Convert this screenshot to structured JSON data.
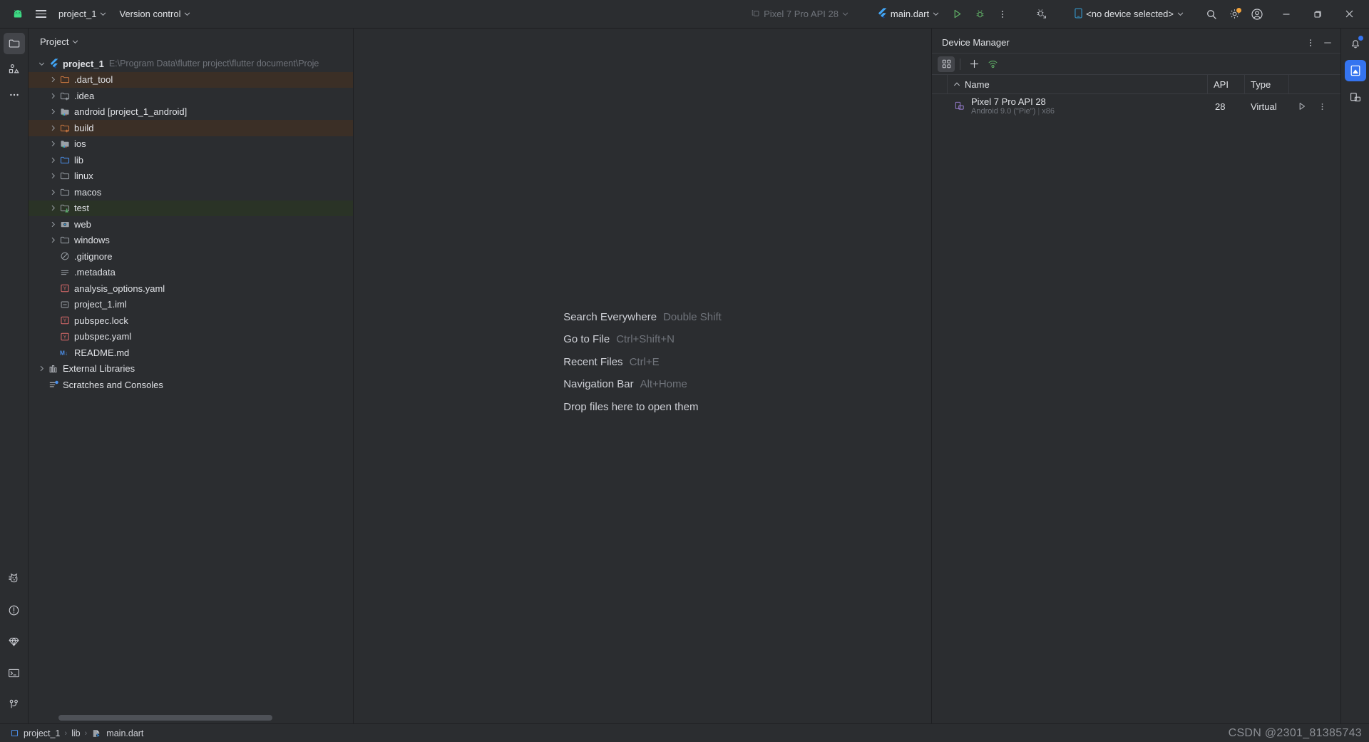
{
  "toolbar": {
    "logo_icon": "android-studio-logo-icon",
    "menu_icon": "hamburger-menu-icon",
    "project_name": "project_1",
    "version_control": "Version control",
    "device_preview": "Pixel 7 Pro API 28",
    "run_config": "main.dart",
    "run_icon": "run-play-icon",
    "debug_icon": "debug-bug-icon",
    "more_icon": "more-vertical-icon",
    "attach_debugger_icon": "attach-debugger-icon",
    "device_selector": "<no device selected>",
    "search_icon": "search-icon",
    "settings_icon": "settings-gear-icon",
    "account_icon": "account-avatar-icon",
    "minimize_icon": "window-minimize-icon",
    "maximize_icon": "window-maximize-icon",
    "close_icon": "window-close-icon"
  },
  "left_rail": {
    "top": [
      {
        "name": "project-tool-icon",
        "active": true
      },
      {
        "name": "structure-tool-icon",
        "active": false
      },
      {
        "name": "more-tool-windows-icon",
        "active": false
      }
    ],
    "bottom": [
      {
        "name": "dart-analysis-cat-icon"
      },
      {
        "name": "problems-warning-icon"
      },
      {
        "name": "flutter-inspector-diamond-icon"
      },
      {
        "name": "terminal-icon"
      },
      {
        "name": "version-control-branch-icon"
      }
    ]
  },
  "project_panel": {
    "header": "Project",
    "header_chevron_icon": "chevron-down-icon",
    "tree": [
      {
        "label": "project_1",
        "path": "E:\\Program Data\\flutter project\\flutter document\\Proje",
        "icon": "flutter-icon",
        "arrow": "down",
        "indent": 0,
        "bold": true,
        "highlight": "none"
      },
      {
        "label": ".dart_tool",
        "icon": "folder-excluded-icon",
        "arrow": "right",
        "indent": 1,
        "bold": false,
        "highlight": "excluded"
      },
      {
        "label": ".idea",
        "icon": "folder-module-icon",
        "arrow": "right",
        "indent": 1,
        "bold": false,
        "highlight": "none"
      },
      {
        "label": "android [project_1_android]",
        "icon": "folder-android-icon",
        "arrow": "right",
        "indent": 1,
        "bold": false,
        "highlight": "none"
      },
      {
        "label": "build",
        "icon": "folder-excluded-module-icon",
        "arrow": "right",
        "indent": 1,
        "bold": false,
        "highlight": "excluded"
      },
      {
        "label": "ios",
        "icon": "folder-android-icon",
        "arrow": "right",
        "indent": 1,
        "bold": false,
        "highlight": "none"
      },
      {
        "label": "lib",
        "icon": "folder-source-icon",
        "arrow": "right",
        "indent": 1,
        "bold": false,
        "highlight": "none"
      },
      {
        "label": "linux",
        "icon": "folder-icon",
        "arrow": "right",
        "indent": 1,
        "bold": false,
        "highlight": "none"
      },
      {
        "label": "macos",
        "icon": "folder-icon",
        "arrow": "right",
        "indent": 1,
        "bold": false,
        "highlight": "none"
      },
      {
        "label": "test",
        "icon": "folder-test-icon",
        "arrow": "right",
        "indent": 1,
        "bold": false,
        "highlight": "test"
      },
      {
        "label": "web",
        "icon": "folder-web-icon",
        "arrow": "right",
        "indent": 1,
        "bold": false,
        "highlight": "none"
      },
      {
        "label": "windows",
        "icon": "folder-icon",
        "arrow": "right",
        "indent": 1,
        "bold": false,
        "highlight": "none"
      },
      {
        "label": ".gitignore",
        "icon": "gitignore-icon",
        "arrow": "none",
        "indent": 1,
        "bold": false,
        "highlight": "none"
      },
      {
        "label": ".metadata",
        "icon": "metadata-lines-icon",
        "arrow": "none",
        "indent": 1,
        "bold": false,
        "highlight": "none"
      },
      {
        "label": "analysis_options.yaml",
        "icon": "yaml-file-icon",
        "arrow": "none",
        "indent": 1,
        "bold": false,
        "highlight": "none"
      },
      {
        "label": "project_1.iml",
        "icon": "iml-file-icon",
        "arrow": "none",
        "indent": 1,
        "bold": false,
        "highlight": "none"
      },
      {
        "label": "pubspec.lock",
        "icon": "yaml-file-icon",
        "arrow": "none",
        "indent": 1,
        "bold": false,
        "highlight": "none"
      },
      {
        "label": "pubspec.yaml",
        "icon": "yaml-file-icon",
        "arrow": "none",
        "indent": 1,
        "bold": false,
        "highlight": "none"
      },
      {
        "label": "README.md",
        "icon": "markdown-file-icon",
        "arrow": "none",
        "indent": 1,
        "bold": false,
        "highlight": "none"
      },
      {
        "label": "External Libraries",
        "icon": "external-libraries-icon",
        "arrow": "right",
        "indent": 0,
        "bold": false,
        "highlight": "none"
      },
      {
        "label": "Scratches and Consoles",
        "icon": "scratches-icon",
        "arrow": "none",
        "indent": 0,
        "bold": false,
        "highlight": "none"
      }
    ]
  },
  "editor": {
    "hints": [
      {
        "action": "Search Everywhere",
        "shortcut": "Double Shift"
      },
      {
        "action": "Go to File",
        "shortcut": "Ctrl+Shift+N"
      },
      {
        "action": "Recent Files",
        "shortcut": "Ctrl+E"
      },
      {
        "action": "Navigation Bar",
        "shortcut": "Alt+Home"
      },
      {
        "action": "Drop files here to open them",
        "shortcut": ""
      }
    ]
  },
  "device_manager": {
    "title": "Device Manager",
    "options_icon": "more-vertical-icon",
    "hide_icon": "hide-panel-minimize-icon",
    "toolbar": [
      {
        "name": "device-list-grid-icon",
        "on": true
      },
      {
        "name": "add-device-plus-icon",
        "on": false
      },
      {
        "name": "pair-wifi-device-icon",
        "on": false
      }
    ],
    "columns": {
      "sort_icon": "sort-ascending-icon",
      "name": "Name",
      "api": "API",
      "type": "Type"
    },
    "devices": [
      {
        "icon": "virtual-device-icon",
        "name": "Pixel 7 Pro API 28",
        "subtitle_os": "Android 9.0 (\"Pie\")",
        "subtitle_arch": "x86",
        "api": "28",
        "type": "Virtual",
        "run_icon": "run-device-play-icon",
        "more_icon": "more-vertical-icon"
      }
    ]
  },
  "right_rail": [
    {
      "name": "notifications-bell-icon",
      "selected": false,
      "dot": true
    },
    {
      "name": "device-manager-icon",
      "selected": true,
      "dot": false
    },
    {
      "name": "device-file-explorer-icon",
      "selected": false,
      "dot": false
    }
  ],
  "status_bar": {
    "breadcrumb": [
      {
        "label": "project_1",
        "icon": "module-icon"
      },
      {
        "label": "lib",
        "icon": "none"
      },
      {
        "label": "main.dart",
        "icon": "dart-file-icon"
      }
    ],
    "separator": "›",
    "watermark": "CSDN @2301_81385743"
  },
  "colors": {
    "background": "#2b2d30",
    "border": "#1e1f22",
    "accent_blue": "#3574f0",
    "excluded_row": "#3b2f26",
    "test_row": "#2a3326",
    "muted_text": "#6f737a",
    "text": "#dfe1e5",
    "flutter_blue": "#42a5f5",
    "green_run": "#5fad65",
    "orange_badge": "#f2a33c"
  }
}
